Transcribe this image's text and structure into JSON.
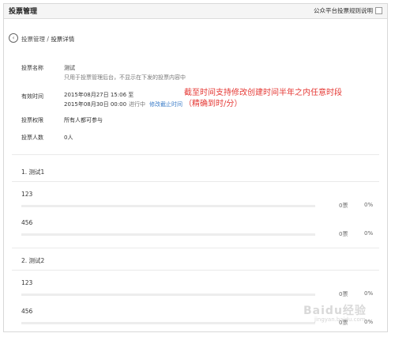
{
  "header": {
    "title": "投票管理",
    "rules_link": "公众平台投票规则说明"
  },
  "breadcrumb": {
    "parent": "投票管理",
    "separator": "/",
    "current": "投票详情"
  },
  "details": {
    "name_label": "投票名称",
    "name_value": "测试",
    "name_hint": "只用于投票管理后台，不显示在下发的投票内容中",
    "time_label": "有效时间",
    "time_start": "2015年08月27日 15:06 至",
    "time_end": "2015年08月30日 00:00",
    "status": "进行中",
    "edit_time_link": "修改截止时间",
    "permission_label": "投票权限",
    "permission_value": "所有人都可参与",
    "count_label": "投票人数",
    "count_value": "0人"
  },
  "annotation": {
    "line1": "截至时间支持修改创建时间半年之内任意时段",
    "line2": "（精确到时/分）"
  },
  "questions": [
    {
      "title": "1. 测试1",
      "options": [
        {
          "label": "123",
          "votes": "0票",
          "percent": "0%",
          "fill": 0
        },
        {
          "label": "456",
          "votes": "0票",
          "percent": "0%",
          "fill": 0
        }
      ]
    },
    {
      "title": "2. 测试2",
      "options": [
        {
          "label": "123",
          "votes": "0票",
          "percent": "0%",
          "fill": 0
        },
        {
          "label": "456",
          "votes": "0票",
          "percent": "0%",
          "fill": 0
        }
      ]
    }
  ],
  "watermark": {
    "main": "Baidu经验",
    "sub": "jingyan.baidu.com"
  }
}
